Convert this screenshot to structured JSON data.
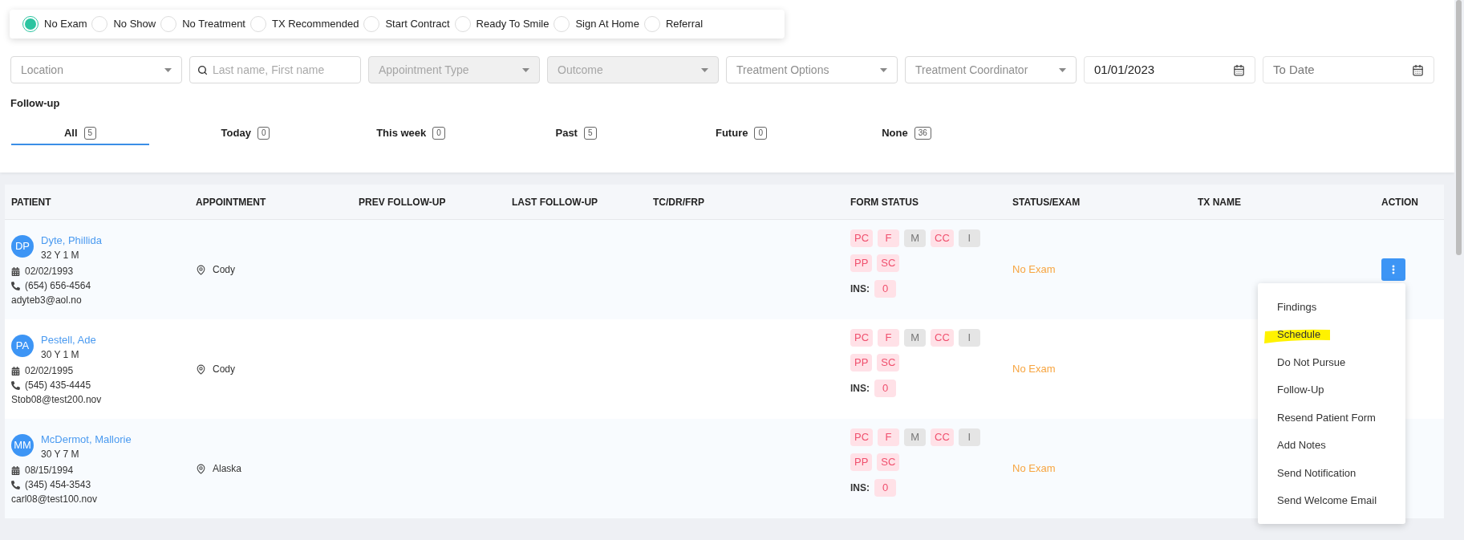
{
  "status_filter": [
    {
      "label": "No Exam",
      "selected": true
    },
    {
      "label": "No Show",
      "selected": false
    },
    {
      "label": "No Treatment",
      "selected": false
    },
    {
      "label": "TX Recommended",
      "selected": false
    },
    {
      "label": "Start Contract",
      "selected": false
    },
    {
      "label": "Ready To Smile",
      "selected": false
    },
    {
      "label": "Sign At Home",
      "selected": false
    },
    {
      "label": "Referral",
      "selected": false
    }
  ],
  "filters": [
    {
      "kind": "select",
      "placeholder": "Location",
      "disabled": false
    },
    {
      "kind": "search",
      "placeholder": "Last name, First name"
    },
    {
      "kind": "select",
      "placeholder": "Appointment Type",
      "disabled": true
    },
    {
      "kind": "select",
      "placeholder": "Outcome",
      "disabled": true
    },
    {
      "kind": "select",
      "placeholder": "Treatment Options",
      "disabled": false
    },
    {
      "kind": "select",
      "placeholder": "Treatment Coordinator",
      "disabled": false
    },
    {
      "kind": "date",
      "value": "01/01/2023"
    },
    {
      "kind": "date",
      "placeholder": "To Date"
    }
  ],
  "followup": {
    "title": "Follow-up",
    "tabs": [
      {
        "label": "All",
        "count": "5",
        "selected": true
      },
      {
        "label": "Today",
        "count": "0",
        "selected": false
      },
      {
        "label": "This week",
        "count": "0",
        "selected": false
      },
      {
        "label": "Past",
        "count": "5",
        "selected": false
      },
      {
        "label": "Future",
        "count": "0",
        "selected": false
      },
      {
        "label": "None",
        "count": "36",
        "selected": false
      }
    ]
  },
  "table": {
    "columns": [
      "PATIENT",
      "APPOINTMENT",
      "PREV FOLLOW-UP",
      "LAST FOLLOW-UP",
      "TC/DR/FRP",
      "FORM STATUS",
      "STATUS/EXAM",
      "TX NAME",
      "ACTION"
    ],
    "rows": [
      {
        "initials": "DP",
        "name": "Dyte, Phillida",
        "age": "32 Y 1 M",
        "dob": "02/02/1993",
        "phone": "(654) 656-4564",
        "email": "adyteb3@aol.no",
        "location": "Cody",
        "forms": [
          {
            "label": "PC",
            "color": "#f0506e"
          },
          {
            "label": "F",
            "color": "#f0506e"
          },
          {
            "label": "M",
            "color": "#777777"
          },
          {
            "label": "CC",
            "color": "#f0506e"
          },
          {
            "label": "I",
            "color": "#777777"
          },
          {
            "label": "PP",
            "color": "#f0506e"
          },
          {
            "label": "SC",
            "color": "#f0506e"
          }
        ],
        "ins_label": "INS:",
        "ins": "0",
        "status": "No Exam",
        "action": true
      },
      {
        "initials": "PA",
        "name": "Pestell, Ade",
        "age": "30 Y 1 M",
        "dob": "02/02/1995",
        "phone": "(545) 435-4445",
        "email": "Stob08@test200.nov",
        "location": "Cody",
        "forms": [
          {
            "label": "PC",
            "color": "#f0506e"
          },
          {
            "label": "F",
            "color": "#f0506e"
          },
          {
            "label": "M",
            "color": "#777777"
          },
          {
            "label": "CC",
            "color": "#f0506e"
          },
          {
            "label": "I",
            "color": "#777777"
          },
          {
            "label": "PP",
            "color": "#f0506e"
          },
          {
            "label": "SC",
            "color": "#f0506e"
          }
        ],
        "ins_label": "INS:",
        "ins": "0",
        "status": "No Exam"
      },
      {
        "initials": "MM",
        "name": "McDermot, Mallorie",
        "age": "30 Y 7 M",
        "dob": "08/15/1994",
        "phone": "(345) 454-3543",
        "email": "carl08@test100.nov",
        "location": "Alaska",
        "forms": [
          {
            "label": "PC",
            "color": "#f0506e"
          },
          {
            "label": "F",
            "color": "#f0506e"
          },
          {
            "label": "M",
            "color": "#777777"
          },
          {
            "label": "CC",
            "color": "#f0506e"
          },
          {
            "label": "I",
            "color": "#777777"
          },
          {
            "label": "PP",
            "color": "#f0506e"
          },
          {
            "label": "SC",
            "color": "#f0506e"
          }
        ],
        "ins_label": "INS:",
        "ins": "0",
        "status": "No Exam"
      }
    ]
  },
  "action_menu": {
    "items": [
      {
        "label": "Findings",
        "highlighted": false
      },
      {
        "label": "Schedule",
        "highlighted": true
      },
      {
        "label": "Do Not Pursue",
        "highlighted": false
      },
      {
        "label": "Follow-Up",
        "highlighted": false
      },
      {
        "label": "Resend Patient Form",
        "highlighted": false
      },
      {
        "label": "Add Notes",
        "highlighted": false
      },
      {
        "label": "Send Notification",
        "highlighted": false
      },
      {
        "label": "Send Welcome Email",
        "highlighted": false
      }
    ]
  }
}
